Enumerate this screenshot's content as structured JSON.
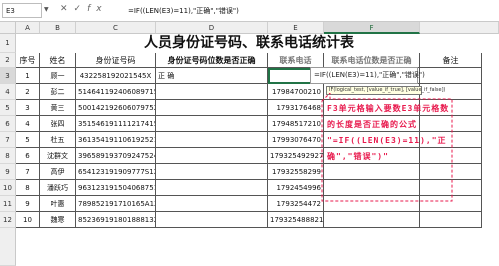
{
  "formula_bar": {
    "name_box": "E3",
    "icons": [
      "cancel-icon",
      "confirm-icon",
      "function-icon"
    ],
    "formula": "=IF((LEN(E3)=11),\"正确\",\"错误\")"
  },
  "column_headers": [
    "A",
    "B",
    "C",
    "D",
    "E",
    "F"
  ],
  "row_numbers": [
    "1",
    "2",
    "3",
    "4",
    "5",
    "6",
    "7",
    "8",
    "9",
    "10",
    "11",
    "12"
  ],
  "sheet": {
    "title": "人员身份证号码、联系电话统计表",
    "headers": {
      "seq": "序号",
      "name": "姓名",
      "id": "身份证号码",
      "id_check": "身份证号码位数是否正确",
      "phone": "联系电话",
      "phone_check": "联系电话位数是否正确",
      "remark": "备注"
    },
    "rows": [
      {
        "seq": "1",
        "name": "顾一",
        "id": "432258192021545X",
        "id_check": "正 确",
        "phone": ""
      },
      {
        "seq": "2",
        "name": "彭二",
        "id": "514641192406089715",
        "id_check": "",
        "phone": "17984700210"
      },
      {
        "seq": "3",
        "name": "黄三",
        "id": "500142192606079752X",
        "id_check": "",
        "phone": "1793176468"
      },
      {
        "seq": "4",
        "name": "张四",
        "id": "351546191111217415",
        "id_check": "",
        "phone": "17948517210"
      },
      {
        "seq": "5",
        "name": "杜五",
        "id": "361354191106192521",
        "id_check": "",
        "phone": "17993076470"
      },
      {
        "seq": "6",
        "name": "沈群文",
        "id": "396589193709247524",
        "id_check": "",
        "phone": "179325492927"
      },
      {
        "seq": "7",
        "name": "高伊",
        "id": "654123191909777S1X",
        "id_check": "",
        "phone": "17932558299"
      },
      {
        "seq": "8",
        "name": "潘跃巧",
        "id": "963123191504068751",
        "id_check": "",
        "phone": "1792454996"
      },
      {
        "seq": "9",
        "name": "叶惠",
        "id": "789852191710165A1X",
        "id_check": "",
        "phone": "1793254472"
      },
      {
        "seq": "10",
        "name": "魏寒",
        "id": "852369191801888132I",
        "id_check": "",
        "phone": "179325488821"
      }
    ]
  },
  "editor": {
    "text": "=IF((LEN(E3)=11),\"正确\",\"错误\")",
    "tooltip": "IF(logical_test, [value_if_true], [value_if_false])"
  },
  "annotation": {
    "text": "F3单元格输入要数E3单元格数的长度是否正确的公式\n\"=IF((LEN(E3)=11),\"正确\",\"错误\")\"",
    "color": "#e8194d"
  },
  "colors": {
    "selection": "#217346",
    "header_bg": "#efefef"
  }
}
